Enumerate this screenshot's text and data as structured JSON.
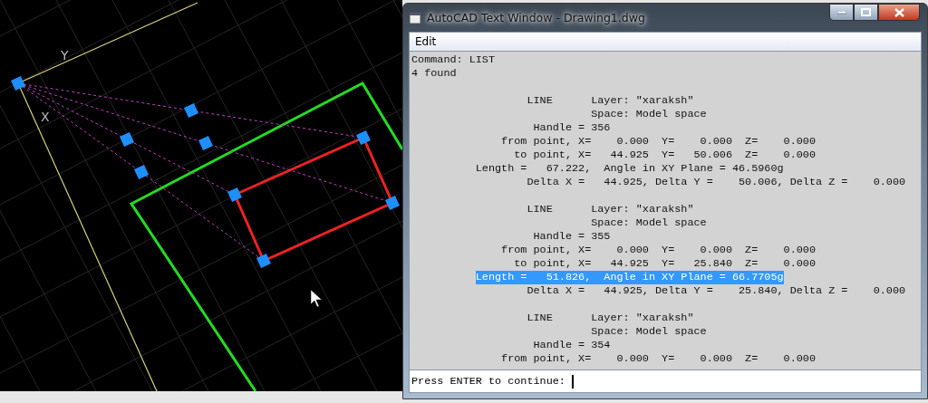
{
  "canvas": {
    "axis_labels": [
      "Y",
      "X"
    ]
  },
  "window": {
    "title": "AutoCAD Text Window - Drawing1.dwg"
  },
  "menu": [
    {
      "label": "Edit"
    }
  ],
  "output": [
    {
      "lines": [
        {
          "text": "Command: LIST",
          "selected": false
        },
        {
          "text": "4 found",
          "selected": false
        }
      ]
    },
    {
      "lines": [
        {
          "text": "                  LINE      Layer: \"xaraksh\"",
          "selected": false
        },
        {
          "text": "                            Space: Model space",
          "selected": false
        },
        {
          "text": "                   Handle = 356",
          "selected": false
        },
        {
          "text": "              from point, X=    0.000  Y=    0.000  Z=    0.000",
          "selected": false
        },
        {
          "text": "                to point, X=   44.925  Y=   50.006  Z=    0.000",
          "selected": false
        },
        {
          "text": "          Length =   67.222,  Angle in XY Plane = 46.5960g",
          "selected": false
        },
        {
          "text": "                  Delta X =   44.925, Delta Y =    50.006, Delta Z =    0.000",
          "selected": false
        }
      ]
    },
    {
      "lines": [
        {
          "text": "                  LINE      Layer: \"xaraksh\"",
          "selected": false
        },
        {
          "text": "                            Space: Model space",
          "selected": false
        },
        {
          "text": "                   Handle = 355",
          "selected": false
        },
        {
          "text": "              from point, X=    0.000  Y=    0.000  Z=    0.000",
          "selected": false
        },
        {
          "text": "                to point, X=   44.925  Y=   25.840  Z=    0.000",
          "selected": false
        },
        {
          "text": "          Length =   51.826,  Angle in XY Plane = 66.7705g",
          "selected": true
        },
        {
          "text": "                  Delta X =   44.925, Delta Y =    25.840, Delta Z =    0.000",
          "selected": false
        }
      ]
    },
    {
      "lines": [
        {
          "text": "                  LINE      Layer: \"xaraksh\"",
          "selected": false
        },
        {
          "text": "                            Space: Model space",
          "selected": false
        },
        {
          "text": "                   Handle = 354",
          "selected": false
        },
        {
          "text": "              from point, X=    0.000  Y=    0.000  Z=    0.000",
          "selected": false
        }
      ]
    }
  ],
  "prompt": {
    "value": "Press ENTER to continue:"
  }
}
